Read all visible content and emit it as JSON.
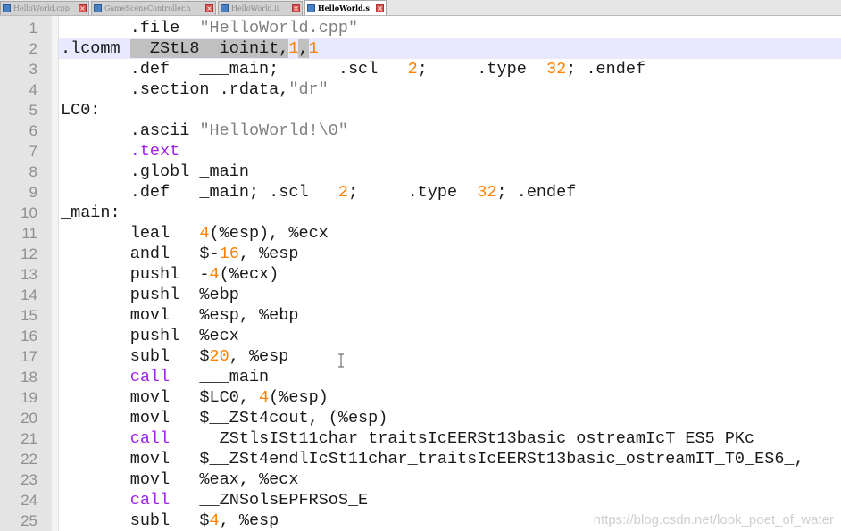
{
  "tabs": [
    {
      "label": "HelloWorld.cpp",
      "active": false
    },
    {
      "label": "GameSceneController.h",
      "active": false
    },
    {
      "label": "HelloWorld.ii",
      "active": false
    },
    {
      "label": "HelloWorld.s",
      "active": true
    }
  ],
  "colors": {
    "keyword": "#a020f0",
    "number": "#ff8000",
    "string": "#808080",
    "current_line": "#e8e8ff",
    "gutter": "#e4e4e4"
  },
  "lines": [
    {
      "n": "1",
      "t": [
        [
          "",
          "\t.file\t"
        ],
        [
          "str",
          "\"HelloWorld.cpp\""
        ]
      ]
    },
    {
      "n": "2",
      "cur": true,
      "t": [
        [
          "",
          ".lcomm "
        ],
        [
          "hl",
          "__ZStL8__ioinit,"
        ],
        [
          "num",
          "1"
        ],
        [
          "hl",
          ","
        ],
        [
          "num",
          "1"
        ]
      ]
    },
    {
      "n": "3",
      "t": [
        [
          "",
          "\t.def\t___main;\t.scl\t"
        ],
        [
          "num",
          "2"
        ],
        [
          "",
          ";\t.type\t"
        ],
        [
          "num",
          "32"
        ],
        [
          "",
          "; .endef"
        ]
      ]
    },
    {
      "n": "4",
      "t": [
        [
          "",
          "\t.section .rdata,"
        ],
        [
          "str",
          "\"dr\""
        ]
      ]
    },
    {
      "n": "5",
      "t": [
        [
          "",
          "LC0:"
        ]
      ]
    },
    {
      "n": "6",
      "t": [
        [
          "",
          "\t.ascii "
        ],
        [
          "str",
          "\"HelloWorld!\\0\""
        ]
      ]
    },
    {
      "n": "7",
      "t": [
        [
          "kw",
          "\t.text"
        ]
      ]
    },
    {
      "n": "8",
      "t": [
        [
          "",
          "\t.globl\t_main"
        ]
      ]
    },
    {
      "n": "9",
      "t": [
        [
          "",
          "\t.def\t_main;\t.scl\t"
        ],
        [
          "num",
          "2"
        ],
        [
          "",
          ";\t.type\t"
        ],
        [
          "num",
          "32"
        ],
        [
          "",
          "; .endef"
        ]
      ]
    },
    {
      "n": "10",
      "t": [
        [
          "",
          "_main:"
        ]
      ]
    },
    {
      "n": "11",
      "t": [
        [
          "",
          "\tleal\t"
        ],
        [
          "num",
          "4"
        ],
        [
          "",
          "(%esp), %ecx"
        ]
      ]
    },
    {
      "n": "12",
      "t": [
        [
          "",
          "\tandl\t$-"
        ],
        [
          "num",
          "16"
        ],
        [
          "",
          ", %esp"
        ]
      ]
    },
    {
      "n": "13",
      "t": [
        [
          "",
          "\tpushl\t-"
        ],
        [
          "num",
          "4"
        ],
        [
          "",
          "(%ecx)"
        ]
      ]
    },
    {
      "n": "14",
      "t": [
        [
          "",
          "\tpushl\t%ebp"
        ]
      ]
    },
    {
      "n": "15",
      "t": [
        [
          "",
          "\tmovl\t%esp, %ebp"
        ]
      ]
    },
    {
      "n": "16",
      "t": [
        [
          "",
          "\tpushl\t%ecx"
        ]
      ]
    },
    {
      "n": "17",
      "t": [
        [
          "",
          "\tsubl\t$"
        ],
        [
          "num",
          "20"
        ],
        [
          "",
          ", %esp"
        ]
      ]
    },
    {
      "n": "18",
      "t": [
        [
          "kw",
          "\tcall"
        ],
        [
          "",
          "\t___main"
        ]
      ]
    },
    {
      "n": "19",
      "t": [
        [
          "",
          "\tmovl\t$LC0, "
        ],
        [
          "num",
          "4"
        ],
        [
          "",
          "(%esp)"
        ]
      ]
    },
    {
      "n": "20",
      "t": [
        [
          "",
          "\tmovl\t$__ZSt4cout, (%esp)"
        ]
      ]
    },
    {
      "n": "21",
      "t": [
        [
          "kw",
          "\tcall"
        ],
        [
          "",
          "\t__ZStlsISt11char_traitsIcEERSt13basic_ostreamIcT_ES5_PKc"
        ]
      ]
    },
    {
      "n": "22",
      "t": [
        [
          "",
          "\tmovl\t$__ZSt4endlIcSt11char_traitsIcEERSt13basic_ostreamIT_T0_ES6_,"
        ]
      ]
    },
    {
      "n": "23",
      "t": [
        [
          "",
          "\tmovl\t%eax, %ecx"
        ]
      ]
    },
    {
      "n": "24",
      "t": [
        [
          "kw",
          "\tcall"
        ],
        [
          "",
          "\t__ZNSolsEPFRSoS_E"
        ]
      ]
    },
    {
      "n": "25",
      "t": [
        [
          "",
          "\tsubl\t$"
        ],
        [
          "num",
          "4"
        ],
        [
          "",
          ", %esp"
        ]
      ]
    }
  ],
  "watermark": "https://blog.csdn.net/look_poet_of_water"
}
